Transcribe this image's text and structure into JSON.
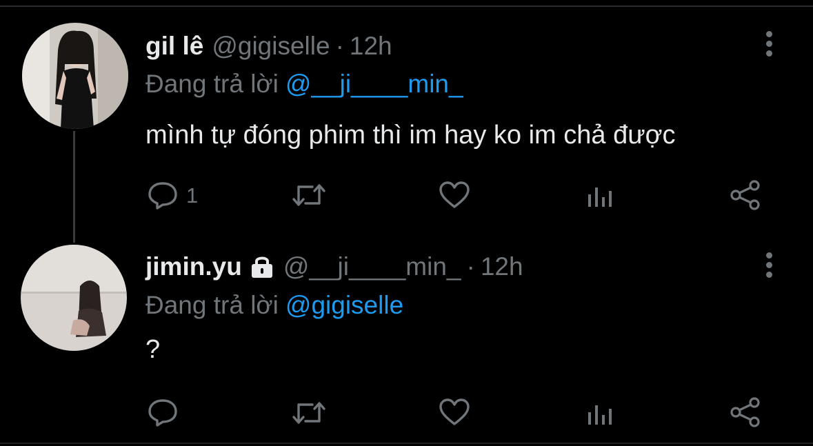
{
  "tweets": [
    {
      "name": "gil lê",
      "handle": "@gigiselle",
      "separator": "·",
      "time": "12h",
      "replying_prefix": "Đang trả lời",
      "replying_to": "@__ji____min_",
      "text": "mình tự đóng phim thì im hay ko im chả được",
      "reply_count": "1",
      "locked": false
    },
    {
      "name": "jimin.yu",
      "handle": "@__ji____min_",
      "separator": "·",
      "time": "12h",
      "replying_prefix": "Đang trả lời",
      "replying_to": "@gigiselle",
      "text": "?",
      "reply_count": "",
      "locked": true
    }
  ],
  "icons": [
    "more-vertical-icon",
    "reply-icon",
    "retweet-icon",
    "like-icon",
    "analytics-icon",
    "share-icon",
    "lock-icon"
  ],
  "colors": {
    "background": "#000000",
    "primary_text": "#e7e9ea",
    "secondary_text": "#71767b",
    "accent": "#1d9bf0",
    "thread_line": "#3a3d40"
  }
}
